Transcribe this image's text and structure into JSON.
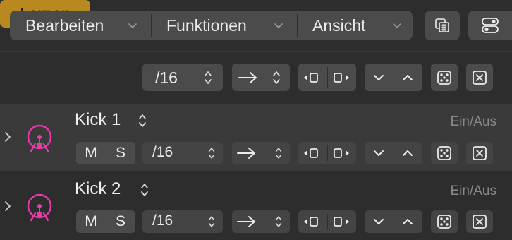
{
  "menubar": {
    "items": [
      {
        "label": "Bearbeiten"
      },
      {
        "label": "Funktionen"
      },
      {
        "label": "Ansicht"
      }
    ]
  },
  "toolbar": {
    "learn_label": "Lernen",
    "division_value": "/16",
    "direction_symbol": "→"
  },
  "rows": [
    {
      "name": "Kick 1",
      "onoff_label": "Ein/Aus",
      "mute_label": "M",
      "solo_label": "S",
      "division_value": "/16",
      "direction_symbol": "→"
    },
    {
      "name": "Kick 2",
      "onoff_label": "Ein/Aus",
      "mute_label": "M",
      "solo_label": "S",
      "division_value": "/16",
      "direction_symbol": "→"
    }
  ],
  "colors": {
    "accent": "#b8891e",
    "drum_icon": "#e83aa8",
    "panel": "#4b4b4b",
    "background": "#2d2d2d"
  },
  "icons": [
    "chevron-down-icon",
    "grid-icon",
    "toggle-icon",
    "stepper-icon",
    "arrow-right-icon",
    "shift-left-icon",
    "shift-right-icon",
    "chevron-down-icon",
    "chevron-up-icon",
    "dice-icon",
    "clear-icon",
    "disclosure-icon",
    "drum-icon"
  ]
}
